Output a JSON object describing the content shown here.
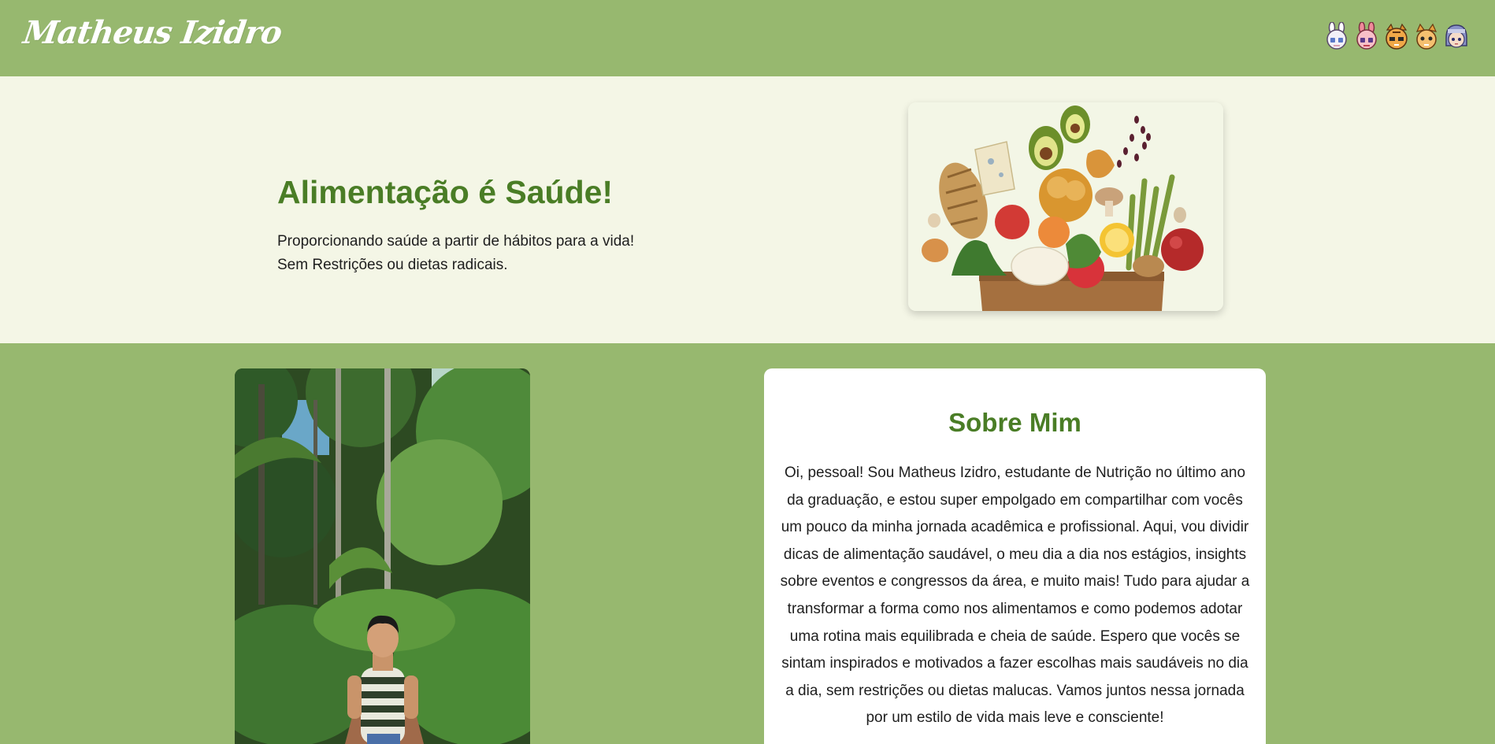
{
  "header": {
    "brand": "Matheus Izidro",
    "avatars": [
      "bunny-white-avatar-icon",
      "bunny-pink-avatar-icon",
      "tiger-avatar-icon",
      "fox-avatar-icon",
      "hooded-avatar-icon"
    ],
    "background": "#97b86f"
  },
  "hero": {
    "title": "Alimentação é Saúde!",
    "line1": "Proporcionando saúde a partir de hábitos para a vida!",
    "line2": "Sem Restrições ou dietas radicais.",
    "image_icon": "grocery-bag-illustration",
    "background": "#f4f6e6",
    "title_color": "#4a7d26"
  },
  "about": {
    "photo_icon": "portrait-photo",
    "title": "Sobre Mim",
    "text": "Oi, pessoal! Sou Matheus Izidro, estudante de Nutrição no último ano da graduação, e estou super empolgado em compartilhar com vocês um pouco da minha jornada acadêmica e profissional. Aqui, vou dividir dicas de alimentação saudável, o meu dia a dia nos estágios, insights sobre eventos e congressos da área, e muito mais! Tudo para ajudar a transformar a forma como nos alimentamos e como podemos adotar uma rotina mais equilibrada e cheia de saúde. Espero que vocês se sintam inspirados e motivados a fazer escolhas mais saudáveis no dia a dia, sem restrições ou dietas malucas. Vamos juntos nessa jornada por um estilo de vida mais leve e consciente!"
  }
}
